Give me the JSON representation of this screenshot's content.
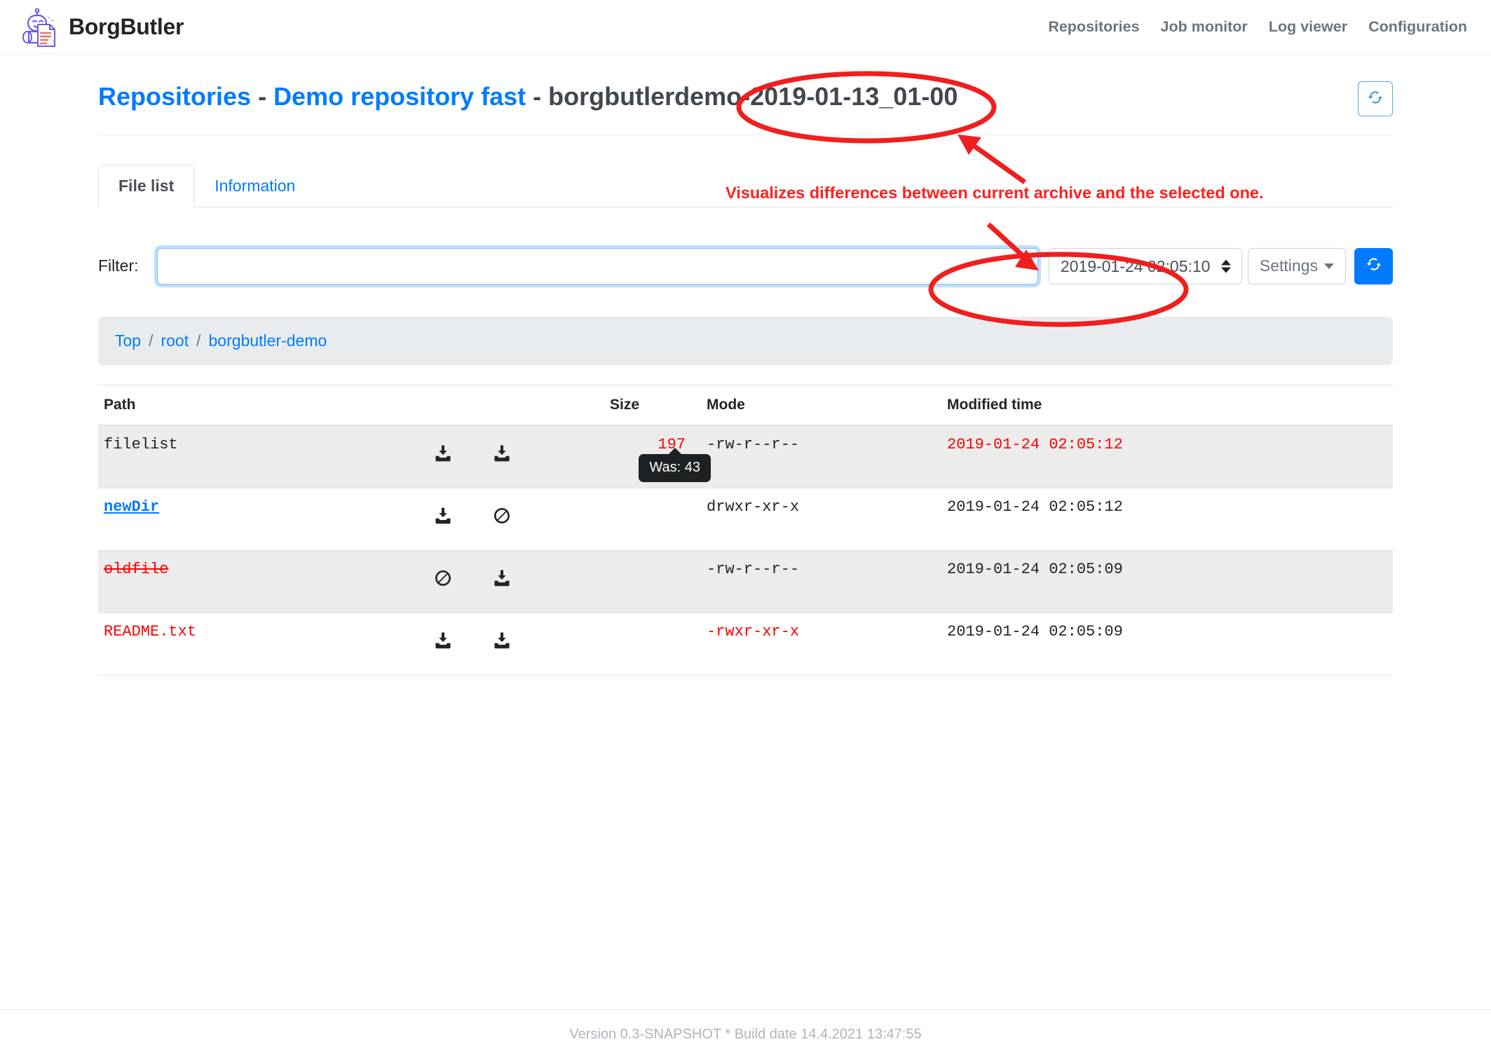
{
  "brand": {
    "name": "BorgButler",
    "logo_icon": "butler-robot-logo"
  },
  "nav": {
    "items": [
      {
        "label": "Repositories",
        "name": "nav-repositories"
      },
      {
        "label": "Job monitor",
        "name": "nav-job-monitor"
      },
      {
        "label": "Log viewer",
        "name": "nav-log-viewer"
      },
      {
        "label": "Configuration",
        "name": "nav-configuration"
      }
    ]
  },
  "page": {
    "title_repositories": "Repositories",
    "sep1": " - ",
    "title_repo": "Demo repository fast",
    "sep2": " - ",
    "title_archive": "borgbutlerdemo-2019-01-13_01-00",
    "refresh_icon": "refresh-icon"
  },
  "tabs": [
    {
      "label": "File list",
      "active": true
    },
    {
      "label": "Information",
      "active": false
    }
  ],
  "filter": {
    "label": "Filter:",
    "value": "",
    "placeholder": ""
  },
  "archive_select": {
    "selected": "2019-01-24 02:05:10",
    "options": [
      "2019-01-24 02:05:10"
    ]
  },
  "settings_button": {
    "label": "Settings",
    "caret_icon": "caret-down-icon"
  },
  "refresh_button": {
    "icon": "refresh-icon"
  },
  "breadcrumb": {
    "items": [
      "Top",
      "root",
      "borgbutler-demo"
    ],
    "separator": "/"
  },
  "table": {
    "headers": [
      "Path",
      "",
      "Size",
      "Mode",
      "Modified time"
    ],
    "rows": [
      {
        "path": "filelist",
        "path_style": "plain",
        "icons": [
          "download-icon",
          "download-icon"
        ],
        "size": "197",
        "size_style": "red",
        "tooltip": "Was: 43",
        "mode": "-rw-r--r--",
        "mode_style": "plain",
        "time": "2019-01-24 02:05:12",
        "time_style": "red"
      },
      {
        "path": "newDir",
        "path_style": "link",
        "icons": [
          "download-icon",
          "ban-icon"
        ],
        "size": "",
        "size_style": "plain",
        "tooltip": "",
        "mode": "drwxr-xr-x",
        "mode_style": "plain",
        "time": "2019-01-24 02:05:12",
        "time_style": "plain"
      },
      {
        "path": "oldfile",
        "path_style": "deleted",
        "icons": [
          "ban-icon",
          "download-icon"
        ],
        "size": "",
        "size_style": "plain",
        "tooltip": "",
        "mode": "-rw-r--r--",
        "mode_style": "plain",
        "time": "2019-01-24 02:05:09",
        "time_style": "plain"
      },
      {
        "path": "README.txt",
        "path_style": "red",
        "icons": [
          "download-icon",
          "download-icon"
        ],
        "size": "",
        "size_style": "plain",
        "tooltip": "",
        "mode": "-rwxr-xr-x",
        "mode_style": "red",
        "time": "2019-01-24 02:05:09",
        "time_style": "plain"
      }
    ]
  },
  "annotation": {
    "text": "Visualizes differences between current archive and the selected one.",
    "color": "#ff2020",
    "shapes": [
      "ellipse-around-archive-name",
      "arrow-up-to-archive-name",
      "arrow-down-to-select",
      "ellipse-around-archive-select"
    ]
  },
  "footer": {
    "text": "Version 0.3-SNAPSHOT * Build date 14.4.2021 13:47:55"
  }
}
